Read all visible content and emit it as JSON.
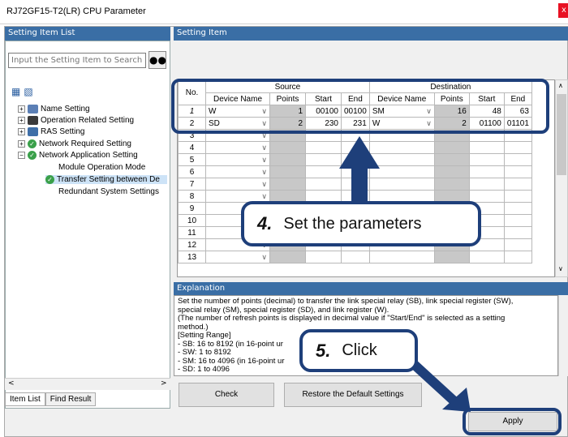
{
  "window": {
    "title": "RJ72GF15-T2(LR) CPU Parameter",
    "close": "x"
  },
  "left": {
    "header": "Setting Item List",
    "search_placeholder": "Input the Setting Item to Search",
    "tree": [
      {
        "label": "Name Setting"
      },
      {
        "label": "Operation Related Setting"
      },
      {
        "label": "RAS Setting"
      },
      {
        "label": "Network Required Setting"
      },
      {
        "label": "Network Application Setting"
      },
      {
        "label": "Module Operation Mode"
      },
      {
        "label": "Transfer Setting between De"
      },
      {
        "label": "Redundant System Settings"
      }
    ],
    "tabs": [
      "Item List",
      "Find Result"
    ]
  },
  "right": {
    "header": "Setting Item",
    "table": {
      "group_source": "Source",
      "group_destination": "Destination",
      "col_no": "No.",
      "columns": [
        "Device Name",
        "Points",
        "Start",
        "End",
        "Device Name",
        "Points",
        "Start",
        "End"
      ],
      "rows": [
        {
          "no": "1",
          "src_dev": "W",
          "src_points": "1",
          "src_start": "00100",
          "src_end": "00100",
          "dst_dev": "SM",
          "dst_points": "16",
          "dst_start": "48",
          "dst_end": "63"
        },
        {
          "no": "2",
          "src_dev": "SD",
          "src_points": "2",
          "src_start": "230",
          "src_end": "231",
          "dst_dev": "W",
          "dst_points": "2",
          "dst_start": "01100",
          "dst_end": "01101"
        },
        {
          "no": "3"
        },
        {
          "no": "4"
        },
        {
          "no": "5"
        },
        {
          "no": "6"
        },
        {
          "no": "7"
        },
        {
          "no": "8"
        },
        {
          "no": "9"
        },
        {
          "no": "10"
        },
        {
          "no": "11"
        },
        {
          "no": "12"
        },
        {
          "no": "13"
        }
      ]
    },
    "explanation_header": "Explanation",
    "explanation": [
      "Set the number of points (decimal) to transfer the link special relay (SB), link special register (SW),",
      "special relay (SM), special register (SD), and link register (W).",
      "(The number of refresh points is displayed in decimal value if \"Start/End\" is selected as a setting",
      "method.)",
      "[Setting Range]",
      "- SB: 16 to 8192 (in 16-point ur",
      "- SW: 1 to 8192",
      "- SM: 16 to 4096 (in 16-point ur",
      "- SD: 1 to 4096"
    ],
    "buttons": {
      "check": "Check",
      "restore": "Restore the Default Settings",
      "apply": "Apply"
    }
  },
  "callouts": {
    "step4_num": "4.",
    "step4_text": "Set the parameters",
    "step5_num": "5.",
    "step5_text": "Click"
  }
}
